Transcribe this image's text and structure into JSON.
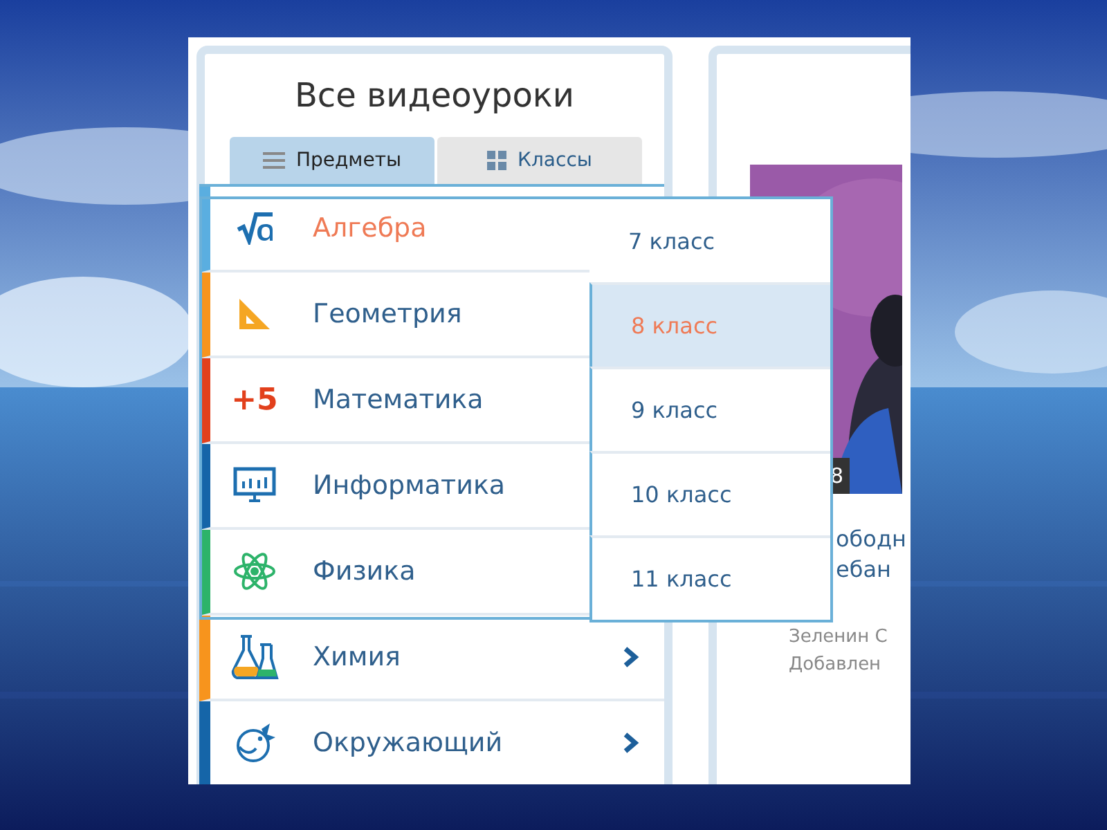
{
  "panel": {
    "title": "Все видеоуроки"
  },
  "tabs": [
    {
      "label": "Предметы",
      "selected": true
    },
    {
      "label": "Классы",
      "selected": false
    }
  ],
  "subjects": [
    {
      "name": "Алгебра",
      "color": "#5aaee0",
      "selected": true,
      "arrow": false
    },
    {
      "name": "Геометрия",
      "color": "#f7941d",
      "selected": false,
      "arrow": false
    },
    {
      "name": "Математика",
      "icon_text": "+5",
      "color": "#e2401c",
      "selected": false,
      "arrow": false
    },
    {
      "name": "Информатика",
      "color": "#1565a8",
      "selected": false,
      "arrow": false
    },
    {
      "name": "Физика",
      "color": "#2db36a",
      "selected": false,
      "arrow": false
    },
    {
      "name": "Химия",
      "color": "#f7941d",
      "selected": false,
      "arrow": true
    },
    {
      "name": "Окружающий",
      "color": "#1565a8",
      "selected": false,
      "arrow": true
    }
  ],
  "grades": [
    {
      "label": "7 класс",
      "selected": false
    },
    {
      "label": "8 класс",
      "selected": true
    },
    {
      "label": "9 класс",
      "selected": false
    },
    {
      "label": "10 класс",
      "selected": false
    },
    {
      "label": "11 класс",
      "selected": false
    }
  ],
  "video": {
    "badge": "8",
    "title_lines": [
      "ободн",
      "ебан"
    ],
    "author": "Зеленин С",
    "added": "Добавлен"
  }
}
